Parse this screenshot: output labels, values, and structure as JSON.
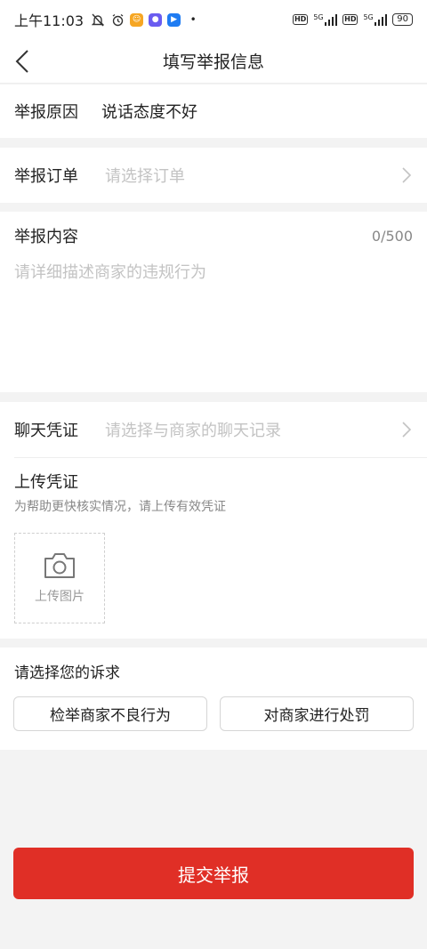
{
  "status_bar": {
    "time": "上午11:03",
    "network_1": "5G",
    "network_2": "5G",
    "battery": "90"
  },
  "nav": {
    "title": "填写举报信息"
  },
  "reason": {
    "label": "举报原因",
    "value": "说话态度不好"
  },
  "order": {
    "label": "举报订单",
    "placeholder": "请选择订单"
  },
  "content": {
    "label": "举报内容",
    "counter": "0/500",
    "placeholder": "请详细描述商家的违规行为"
  },
  "chat": {
    "label": "聊天凭证",
    "placeholder": "请选择与商家的聊天记录"
  },
  "upload": {
    "title": "上传凭证",
    "hint": "为帮助更快核实情况，请上传有效凭证",
    "button_label": "上传图片"
  },
  "appeal": {
    "title": "请选择您的诉求",
    "options": [
      "检举商家不良行为",
      "对商家进行处罚"
    ]
  },
  "submit_label": "提交举报",
  "colors": {
    "accent": "#e02f26",
    "placeholder": "#c3c3c3",
    "background": "#f3f3f3"
  }
}
